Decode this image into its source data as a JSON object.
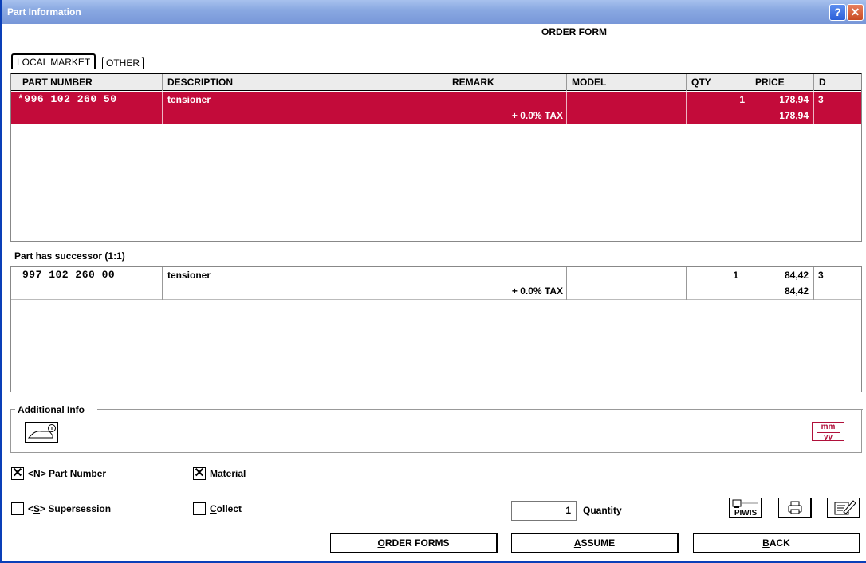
{
  "window": {
    "title": "Part Information",
    "help_label": "?",
    "close_label": "✕"
  },
  "form_title": "ORDER FORM",
  "tabs": [
    {
      "label": "LOCAL MARKET",
      "active": true
    },
    {
      "label": "OTHER",
      "active": false
    }
  ],
  "columns": [
    "PART NUMBER",
    "DESCRIPTION",
    "REMARK",
    "MODEL",
    "QTY",
    "PRICE",
    "D"
  ],
  "main_rows": [
    {
      "part_number": "*996 102 260 50",
      "description": "tensioner",
      "remark": "+ 0.0% TAX",
      "model": "",
      "qty": "1",
      "price": "178,94",
      "price2": "178,94",
      "d": "3",
      "selected": true
    }
  ],
  "successor": {
    "label": "Part has successor (1:1)",
    "rows": [
      {
        "part_number": "997 102 260 00",
        "description": "tensioner",
        "remark": "+ 0.0% TAX",
        "model": "",
        "qty": "1",
        "price": "84,42",
        "price2": "84,42",
        "d": "3"
      }
    ]
  },
  "additional_info": {
    "title": "Additional Info",
    "mmyy_top": "mm",
    "mmyy_bottom": "yy"
  },
  "options": {
    "part_number": {
      "prefix": "<",
      "key": "N",
      "suffix": "> Part Number",
      "checked": true,
      "mark": "✕"
    },
    "supersession": {
      "prefix": "<",
      "key": "S",
      "suffix": "> Supersession",
      "checked": false,
      "mark": ""
    },
    "material": {
      "key": "M",
      "rest": "aterial",
      "checked": true,
      "mark": "✕"
    },
    "collect": {
      "key": "C",
      "rest": "ollect",
      "checked": false,
      "mark": ""
    }
  },
  "quantity": {
    "value": "1",
    "label": "Quantity"
  },
  "piwis_label": "PIWIS",
  "buttons": {
    "order_forms": {
      "key": "O",
      "rest": "RDER FORMS"
    },
    "assume": {
      "key": "A",
      "rest": "SSUME"
    },
    "back": {
      "key": "B",
      "rest": "ACK"
    }
  },
  "colors": {
    "selected_row": "#c30b3a",
    "titlebar": "#8aa9e2",
    "accent": "#b0103a"
  }
}
